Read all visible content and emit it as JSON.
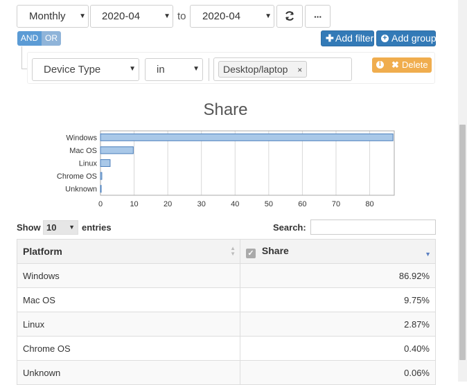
{
  "toolbar": {
    "granularity": "Monthly",
    "from": "2020-04",
    "to_label": "to",
    "to": "2020-04",
    "add_filter": "Add filter",
    "add_group": "Add group"
  },
  "logic": {
    "and": "AND",
    "or": "OR"
  },
  "filter": {
    "field": "Device Type",
    "operator": "in",
    "value_tag": "Desktop/laptop",
    "tag_remove": "×",
    "delete_label": "Delete"
  },
  "chart_data": {
    "type": "bar",
    "orientation": "horizontal",
    "title": "Share",
    "categories": [
      "Windows",
      "Mac OS",
      "Linux",
      "Chrome OS",
      "Unknown"
    ],
    "values": [
      86.92,
      9.75,
      2.87,
      0.4,
      0.06
    ],
    "xlim": [
      0,
      87.3
    ],
    "xticks": [
      0,
      10,
      20,
      30,
      40,
      50,
      60,
      70,
      80
    ],
    "grid": true,
    "bar_color": "#a9c8e8",
    "bar_stroke": "#4a7ebb"
  },
  "table": {
    "show_label": "Show",
    "entries_value": "10",
    "entries_label": "entries",
    "search_label": "Search:",
    "search_value": "",
    "columns": [
      "Platform",
      "Share"
    ],
    "rows": [
      {
        "platform": "Windows",
        "share": "86.92%"
      },
      {
        "platform": "Mac OS",
        "share": "9.75%"
      },
      {
        "platform": "Linux",
        "share": "2.87%"
      },
      {
        "platform": "Chrome OS",
        "share": "0.40%"
      },
      {
        "platform": "Unknown",
        "share": "0.06%"
      }
    ]
  },
  "icons": {
    "refresh": "refresh-icon",
    "more": "ellipsis-icon",
    "plus": "plus-icon",
    "plus_circle": "plus-circle-icon",
    "info": "info-icon",
    "close": "close-icon",
    "checkbox": "checkbox-icon",
    "sort": "sort-icon",
    "sort_desc": "sort-desc-icon"
  },
  "colors": {
    "primary": "#337ab7",
    "logic_active": "#5b9bd5",
    "logic_inactive": "#8fb4d9",
    "warning": "#f0ad4e"
  }
}
